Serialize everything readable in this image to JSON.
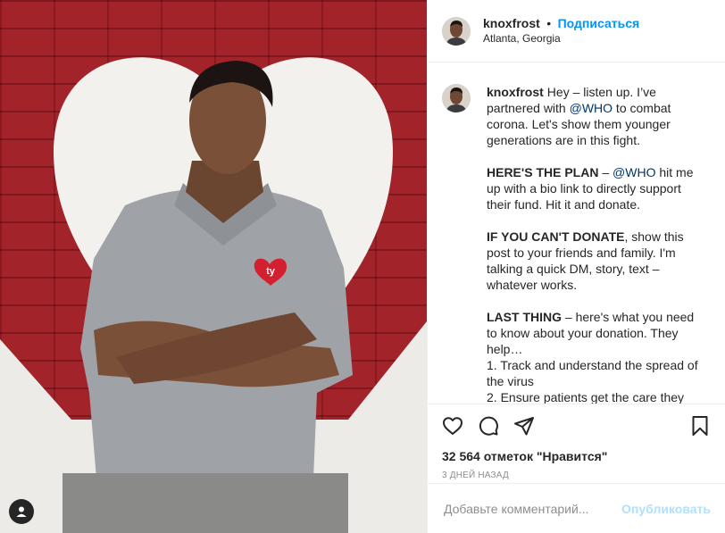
{
  "header": {
    "username": "knoxfrost",
    "separator": "•",
    "follow_label": "Подписаться",
    "location": "Atlanta, Georgia"
  },
  "caption": {
    "username": "knoxfrost",
    "p1_a": "Hey – listen up. I’ve partnered with ",
    "p1_mention": "@WHO",
    "p1_b": " to combat corona. Let's show them younger generations are in this fight.",
    "p2_bold": "HERE'S THE PLAN",
    "p2_a": " – ",
    "p2_mention": "@WHO",
    "p2_b": " hit me up with a bio link to directly support their fund. Hit it and donate.",
    "p3_bold": "IF YOU CAN'T DONATE",
    "p3_a": ", show this post to your friends and family. I'm talking a quick DM, story, text – whatever works.",
    "p4_bold": "LAST THING",
    "p4_a": " – here's what you need to know about your donation. They help…",
    "l1": "1. Track and understand the spread of the virus",
    "l2": "2. Ensure patients get the care they"
  },
  "likes": "32 564 отметок \"Нравится\"",
  "date": "3 дней назад",
  "comment": {
    "placeholder": "Добавьте комментарий...",
    "publish_label": "Опубликовать"
  },
  "colors": {
    "accent": "#0095f6",
    "publish_disabled": "#b2dffc",
    "brick": "#a3232b"
  },
  "icons": [
    "heart-icon",
    "comment-icon",
    "share-icon",
    "bookmark-icon",
    "user-tag-icon"
  ]
}
